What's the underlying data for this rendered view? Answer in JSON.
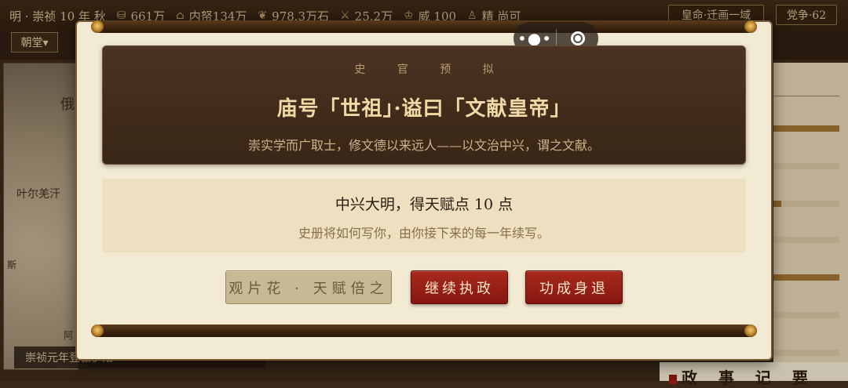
{
  "hud": {
    "era": "明 · 崇祯 10 年 秋",
    "treasury": "661万",
    "inner_treasury": "内帑134万",
    "grain": "978.3万石",
    "army": "25.2万",
    "prestige": "威 100",
    "spirit": "精 尚可",
    "mandate_button": "皇命·迁画一域",
    "faction_button": "党争·62"
  },
  "subbar": {
    "court_button": "朝堂▾"
  },
  "map": {
    "regions": [
      "俄",
      "叶尔羌汗",
      "斯",
      "阿"
    ],
    "caption": "崇祯元年登极伊始"
  },
  "right_panel": {
    "section_title": "政 事 记 要",
    "bar_levels": [
      1.0,
      0.0,
      0.12,
      0.0,
      1.0,
      0.0,
      0.0
    ]
  },
  "capsule": {
    "more_icon": "more-dots-icon",
    "close_icon": "target-circle-icon"
  },
  "title_card": {
    "kicker": "史 官 预 拟",
    "posthumous_title": "庙号「世祖」·谥曰「文献皇帝」",
    "explanation": "崇实学而广取士，修文德以来远人——以文治中兴，谓之文献。"
  },
  "merit_card": {
    "headline": "中兴大明，得天赋点 10 点",
    "subline": "史册将如何写你，由你接下来的每一年续写。"
  },
  "buttons": {
    "view_talents": "观片花 · 天赋倍之",
    "continue_reign": "继续执政",
    "retire": "功成身退"
  },
  "colors": {
    "accent_red": "#a82a1c",
    "parchment": "#f3ead4",
    "dark_wood": "#3a2616",
    "gold": "#f1d9a6"
  }
}
